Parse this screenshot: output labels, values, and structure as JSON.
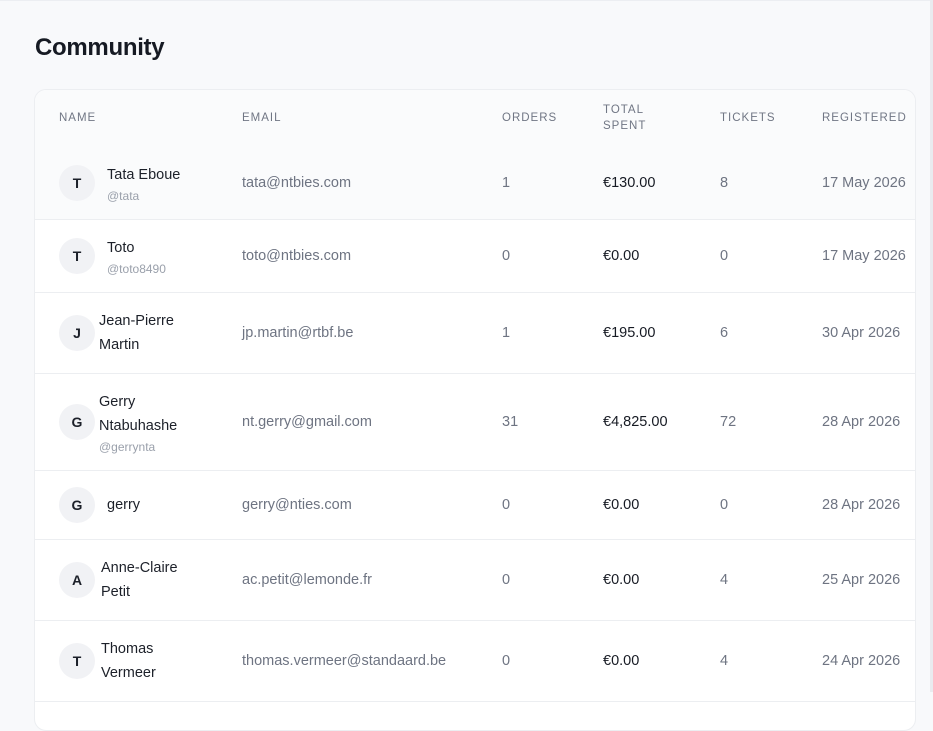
{
  "page": {
    "title": "Community"
  },
  "table": {
    "headers": {
      "name": "NAME",
      "email": "EMAIL",
      "orders": "ORDERS",
      "total_spent_line1": "TOTAL",
      "total_spent_line2": "SPENT",
      "tickets": "TICKETS",
      "registered": "REGISTERED"
    },
    "rows": [
      {
        "initial": "T",
        "name": "Tata Eboue",
        "handle": "@tata",
        "email": "tata@ntbies.com",
        "orders": "1",
        "total_spent": "€130.00",
        "tickets": "8",
        "registered": "17 May 2026"
      },
      {
        "initial": "T",
        "name": "Toto",
        "handle": "@toto8490",
        "email": "toto@ntbies.com",
        "orders": "0",
        "total_spent": "€0.00",
        "tickets": "0",
        "registered": "17 May 2026"
      },
      {
        "initial": "J",
        "name": "Jean-Pierre Martin",
        "handle": "",
        "email": "jp.martin@rtbf.be",
        "orders": "1",
        "total_spent": "€195.00",
        "tickets": "6",
        "registered": "30 Apr 2026"
      },
      {
        "initial": "G",
        "name": "Gerry Ntabuhashe",
        "handle": "@gerrynta",
        "email": "nt.gerry@gmail.com",
        "orders": "31",
        "total_spent": "€4,825.00",
        "tickets": "72",
        "registered": "28 Apr 2026"
      },
      {
        "initial": "G",
        "name": "gerry",
        "handle": "",
        "email": "gerry@nties.com",
        "orders": "0",
        "total_spent": "€0.00",
        "tickets": "0",
        "registered": "28 Apr 2026"
      },
      {
        "initial": "A",
        "name": "Anne-Claire Petit",
        "handle": "",
        "email": "ac.petit@lemonde.fr",
        "orders": "0",
        "total_spent": "€0.00",
        "tickets": "4",
        "registered": "25 Apr 2026"
      },
      {
        "initial": "T",
        "name": "Thomas Vermeer",
        "handle": "",
        "email": "thomas.vermeer@standaard.be",
        "orders": "0",
        "total_spent": "€0.00",
        "tickets": "4",
        "registered": "24 Apr 2026"
      }
    ]
  }
}
